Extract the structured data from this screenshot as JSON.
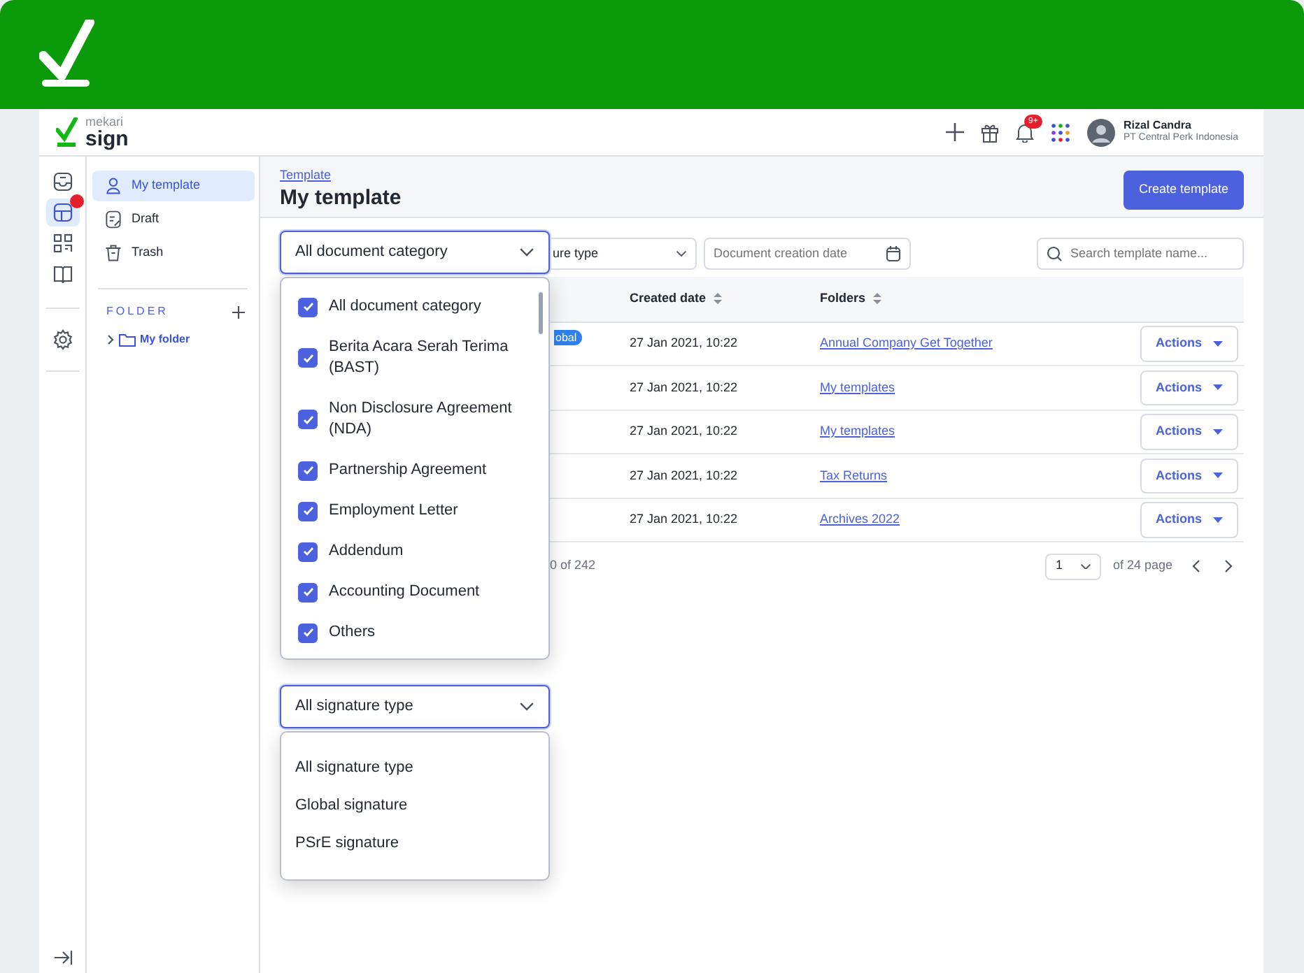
{
  "brand": {
    "tagline": "mekari",
    "name": "sign"
  },
  "header": {
    "notification_badge": "9+",
    "user": {
      "name": "Rizal Candra",
      "company": "PT Central Perk Indonesia"
    }
  },
  "rail": [
    {
      "kind": "inbox",
      "selected": false,
      "alert": false
    },
    {
      "kind": "template",
      "selected": true,
      "alert": true
    },
    {
      "kind": "qr",
      "selected": false,
      "alert": false
    },
    {
      "kind": "book",
      "selected": false,
      "alert": false
    },
    {
      "kind": "settings",
      "selected": false,
      "alert": false
    }
  ],
  "sidebar": {
    "items": [
      {
        "label": "My template",
        "kind": "user",
        "selected": true
      },
      {
        "label": "Draft",
        "kind": "draft",
        "selected": false
      },
      {
        "label": "Trash",
        "kind": "trash",
        "selected": false
      }
    ],
    "folder_heading": "FOLDER",
    "folders": [
      {
        "label": "My folder",
        "expanded": false
      }
    ]
  },
  "page": {
    "breadcrumb": "Template",
    "title": "My template",
    "create_button": "Create template"
  },
  "filters": {
    "category": {
      "value": "All document category",
      "open": true,
      "options": [
        {
          "label": "All document category",
          "checked": true
        },
        {
          "label": "Berita Acara Serah Terima (BAST)",
          "checked": true
        },
        {
          "label": "Non Disclosure Agreement (NDA)",
          "checked": true
        },
        {
          "label": "Partnership Agreement",
          "checked": true
        },
        {
          "label": "Employment Letter",
          "checked": true
        },
        {
          "label": "Addendum",
          "checked": true
        },
        {
          "label": "Accounting Document",
          "checked": true
        },
        {
          "label": "Others",
          "checked": true
        }
      ]
    },
    "signature_type_partial": "ure type",
    "date": {
      "placeholder": "Document creation date"
    },
    "search": {
      "placeholder": "Search template name..."
    }
  },
  "signature_dropdown": {
    "value": "All signature type",
    "open": true,
    "options": [
      {
        "label": "All signature type"
      },
      {
        "label": "Global signature"
      },
      {
        "label": "PSrE signature"
      }
    ]
  },
  "table": {
    "columns": [
      {
        "label": "Created date",
        "sortable": true
      },
      {
        "label": "Folders",
        "sortable": true
      }
    ],
    "rows": [
      {
        "badge_partial": "obal",
        "created": "27 Jan 2021, 10:22",
        "folder": "Annual Company Get Together",
        "action": "Actions"
      },
      {
        "created": "27 Jan 2021, 10:22",
        "folder": "My templates",
        "action": "Actions"
      },
      {
        "created": "27 Jan 2021, 10:22",
        "folder": "My templates",
        "action": "Actions"
      },
      {
        "created": "27 Jan 2021, 10:22",
        "folder": "Tax Returns",
        "action": "Actions"
      },
      {
        "created": "27 Jan 2021, 10:22",
        "folder": "Archives 2022",
        "action": "Actions"
      }
    ]
  },
  "pagination": {
    "summary_partial": "0 of 242",
    "page": "1",
    "total": "of 24 page"
  }
}
